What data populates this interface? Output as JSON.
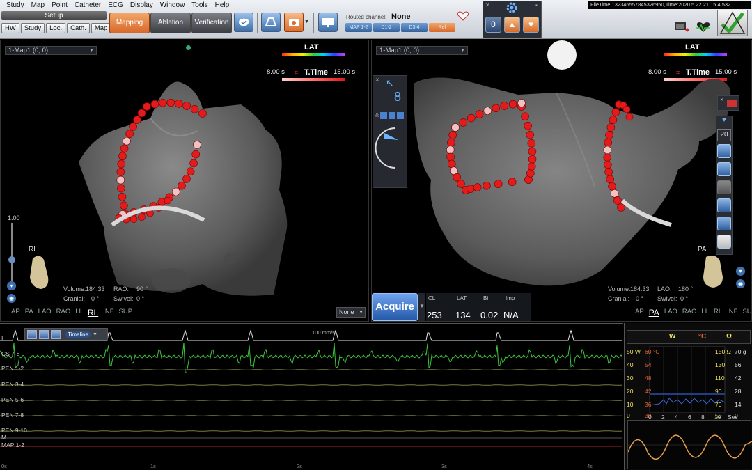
{
  "menu": [
    "Study",
    "Map",
    "Point",
    "Catheter",
    "ECG",
    "Display",
    "Window",
    "Tools",
    "Help"
  ],
  "setup": {
    "title": "Setup",
    "buttons": [
      "HW",
      "Study",
      "Loc.",
      "Cath.",
      "Map"
    ]
  },
  "modes": {
    "mapping": "Mapping",
    "ablation": "Ablation",
    "verification": "Verification"
  },
  "routed": {
    "label": "Routed channel:",
    "value": "None",
    "channels": [
      "MAP 1-2",
      "D1-2",
      "D3-4",
      "Ref"
    ]
  },
  "panel_icons": [
    "0"
  ],
  "filetime": "FileTime:132346557845326950,Time:2020.5.22.21.15.4.532",
  "left_view": {
    "map_select": "1-Map1 (0, 0)",
    "lat": "LAT",
    "ttime_title": "T.Time",
    "ttime_min": "8.00 s",
    "ttime_max": "15.00 s",
    "scale_value": "1.00",
    "orient_badge": "RL",
    "volume_label": "Volume:",
    "volume": "184.33",
    "view_angle_label": "RAO:",
    "view_angle": "90 °",
    "cranial_label": "Cranial:",
    "cranial": "0 °",
    "swivel_label": "Swivel:",
    "swivel": "0 °",
    "orientations": [
      "AP",
      "PA",
      "LAO",
      "RAO",
      "LL",
      "RL",
      "INF",
      "SUP"
    ],
    "selected_orientation": "RL",
    "none_select": "None"
  },
  "right_view": {
    "map_select": "1-Map1 (0, 0)",
    "lat": "LAT",
    "ttime_title": "T.Time",
    "ttime_min": "8.00 s",
    "ttime_max": "15.00 s",
    "side_panel_value": "8",
    "orient_badge": "PA",
    "volume_label": "Volume:",
    "volume": "184.33",
    "view_angle_label": "LAO:",
    "view_angle": "180 °",
    "cranial_label": "Cranial:",
    "cranial": "0 °",
    "swivel_label": "Swivel:",
    "swivel": "0 °",
    "orientations": [
      "AP",
      "PA",
      "LAO",
      "RAO",
      "LL",
      "RL",
      "INF",
      "SUP"
    ],
    "selected_orientation": "PA",
    "tool_counter": "20"
  },
  "acquire": {
    "label": "Acquire",
    "headers": [
      "CL",
      "LAT",
      "Bi",
      "Imp"
    ],
    "values": [
      "253",
      "134",
      "0.02",
      "N/A"
    ]
  },
  "ecg": {
    "speed": "100 mm/s",
    "timeline_label": "Timeline",
    "channels": [
      "I",
      "CS 7-8",
      "PEN 1-2",
      "PEN 3-4",
      "PEN 5-6",
      "PEN 7-8",
      "PEN 9-10",
      "M",
      "MAP 1-2"
    ],
    "ticks": [
      "0s",
      "1s",
      "2s",
      "3s",
      "4s"
    ],
    "colors": {
      "I": "#e8e8e8",
      "CS 7-8": "#3ec63e",
      "PEN": "#7a7a3a",
      "MAP 1-2": "#b02020"
    }
  },
  "ablation": {
    "headers": [
      "W",
      "°C",
      "Ω"
    ],
    "header_colors": [
      "#f0e060",
      "#e06030",
      "#f0e060"
    ],
    "left_axis": [
      "50 W",
      "40",
      "30",
      "20",
      "10",
      "0"
    ],
    "temp_axis": [
      "60 °C",
      "54",
      "48",
      "42",
      "36",
      "30"
    ],
    "right_axis_ohm": [
      "150 Ω",
      "130",
      "110",
      "90",
      "70",
      "50"
    ],
    "right_axis_g": [
      "70 g",
      "56",
      "42",
      "28",
      "14",
      "0"
    ],
    "x_ticks": [
      "0",
      "2",
      "4",
      "6",
      "8",
      "10",
      "Sec"
    ]
  }
}
